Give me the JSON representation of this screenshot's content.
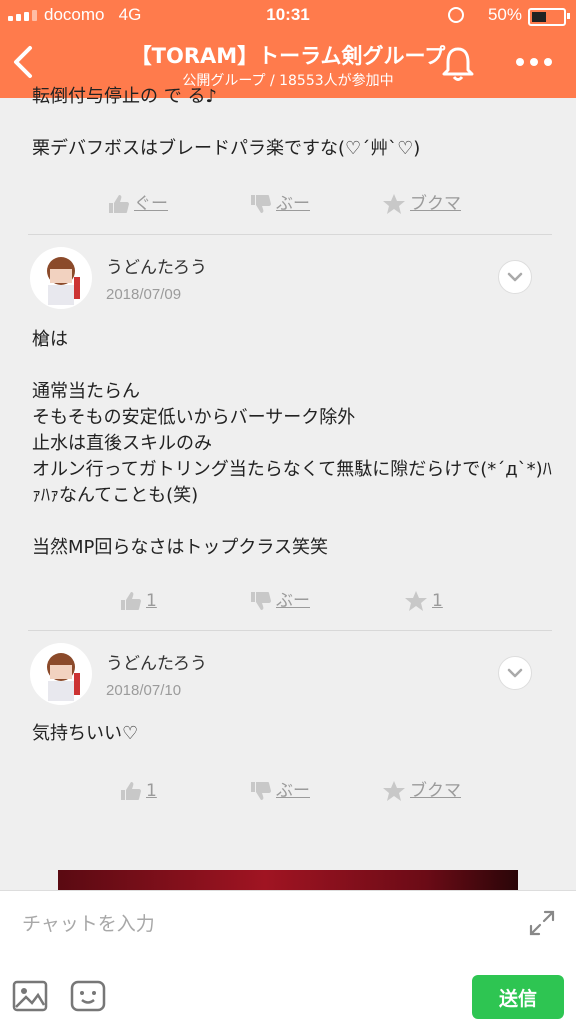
{
  "status_bar": {
    "carrier": "docomo",
    "network": "4G",
    "time": "10:31",
    "battery": "50%"
  },
  "header": {
    "title": "【TORAM】トーラム剣グループ",
    "subtitle": "公開グループ / 18553人が参加中"
  },
  "posts": [
    {
      "text": "転倒付与停止の で る♪\n\n栗デバフボスはブレードパラ楽ですな(♡´艸`♡)",
      "reactions": {
        "good": "ぐー",
        "boo": "ぶー",
        "bookmark": "ブクマ"
      }
    },
    {
      "username": "うどんたろう",
      "date": "2018/07/09",
      "text": "槍は\n\n通常当たらん\nそもそもの安定低いからバーサーク除外\n止水は直後スキルのみ\nオルン行ってガトリング当たらなくて無駄に隙だらけで(*´д`*)ﾊｧﾊｧなんてことも(笑)\n\n当然MP回らなさはトップクラス笑笑",
      "reactions": {
        "good": "1",
        "boo": "ぶー",
        "bookmark": "1"
      }
    },
    {
      "username": "うどんたろう",
      "date": "2018/07/10",
      "text": "気持ちいい♡",
      "reactions": {
        "good": "1",
        "boo": "ぶー",
        "bookmark": "ブクマ"
      }
    }
  ],
  "composer": {
    "placeholder": "チャットを入力",
    "send_label": "送信"
  },
  "colors": {
    "accent": "#ff7b4c",
    "send": "#2ec552",
    "muted": "#9b9b9b"
  }
}
